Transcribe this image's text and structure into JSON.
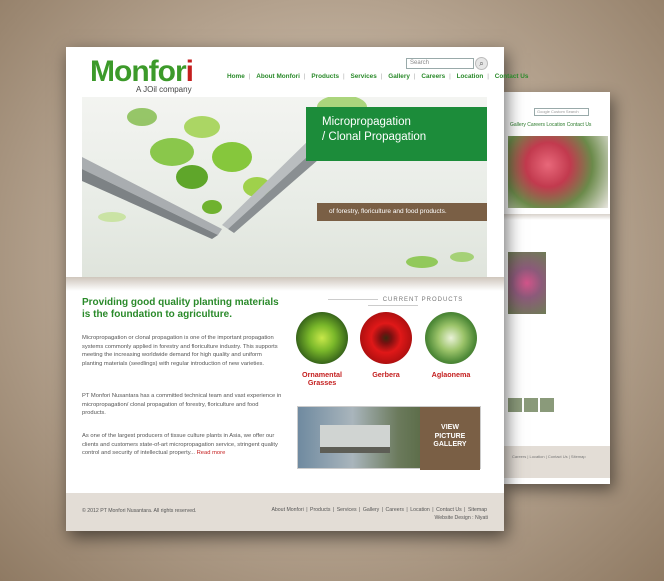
{
  "brand": {
    "name_main": "Monfor",
    "name_end": "i",
    "tagline": "A JOil company"
  },
  "search": {
    "placeholder": "Search"
  },
  "nav": [
    "Home",
    "About Monfori",
    "Products",
    "Services",
    "Gallery",
    "Careers",
    "Location",
    "Contact Us"
  ],
  "hero": {
    "title_line1": "Micropropagation",
    "title_line2": "/ Clonal Propagation",
    "subtitle": "of forestry, floriculture and food products."
  },
  "intro": {
    "headline": "Providing good quality planting materials is the foundation to agriculture.",
    "p1": "Micropropagation or clonal propagation is one of the important propagation systems commonly applied in forestry and floriculture industry. This supports meeting the increasing worldwide demand for high quality and uniform planting materials (seedlings) with regular introduction of new varieties.",
    "p2": "PT Monfori Nusantara has a committed technical team and vast experience in micropropagation/ clonal propagation of forestry, floriculture and food products.",
    "p3": "As one of the largest producers of tissue culture plants in Asia, we offer our clients and customers state-of-art micropropagation service, stringent quality control and security of intellectual property...",
    "read_more": "Read more"
  },
  "products": {
    "title": "CURRENT PRODUCTS",
    "items": [
      {
        "label": "Ornamental Grasses"
      },
      {
        "label": "Gerbera"
      },
      {
        "label": "Aglaonema"
      }
    ]
  },
  "gallery": {
    "label_line1": "VIEW",
    "label_line2": "PICTURE",
    "label_line3": "GALLERY"
  },
  "footer": {
    "copyright": "© 2012 PT Monfori Nusantara. All rights reserved.",
    "links": [
      "About Monfori",
      "Products",
      "Services",
      "Gallery",
      "Careers",
      "Location",
      "Contact Us",
      "Sitemap"
    ],
    "design_credit": "Website Design : Niyati"
  },
  "back_page": {
    "search_placeholder": "Google Custom Search",
    "nav": "Gallery  Careers  Location  Contact Us",
    "footer": "Careers | Location | Contact Us | Sitemap"
  },
  "colors": {
    "brand_green": "#2a8a2a",
    "hero_green": "#1c8c3a",
    "accent_brown": "#7a5f45",
    "link_red": "#c41e1e"
  }
}
